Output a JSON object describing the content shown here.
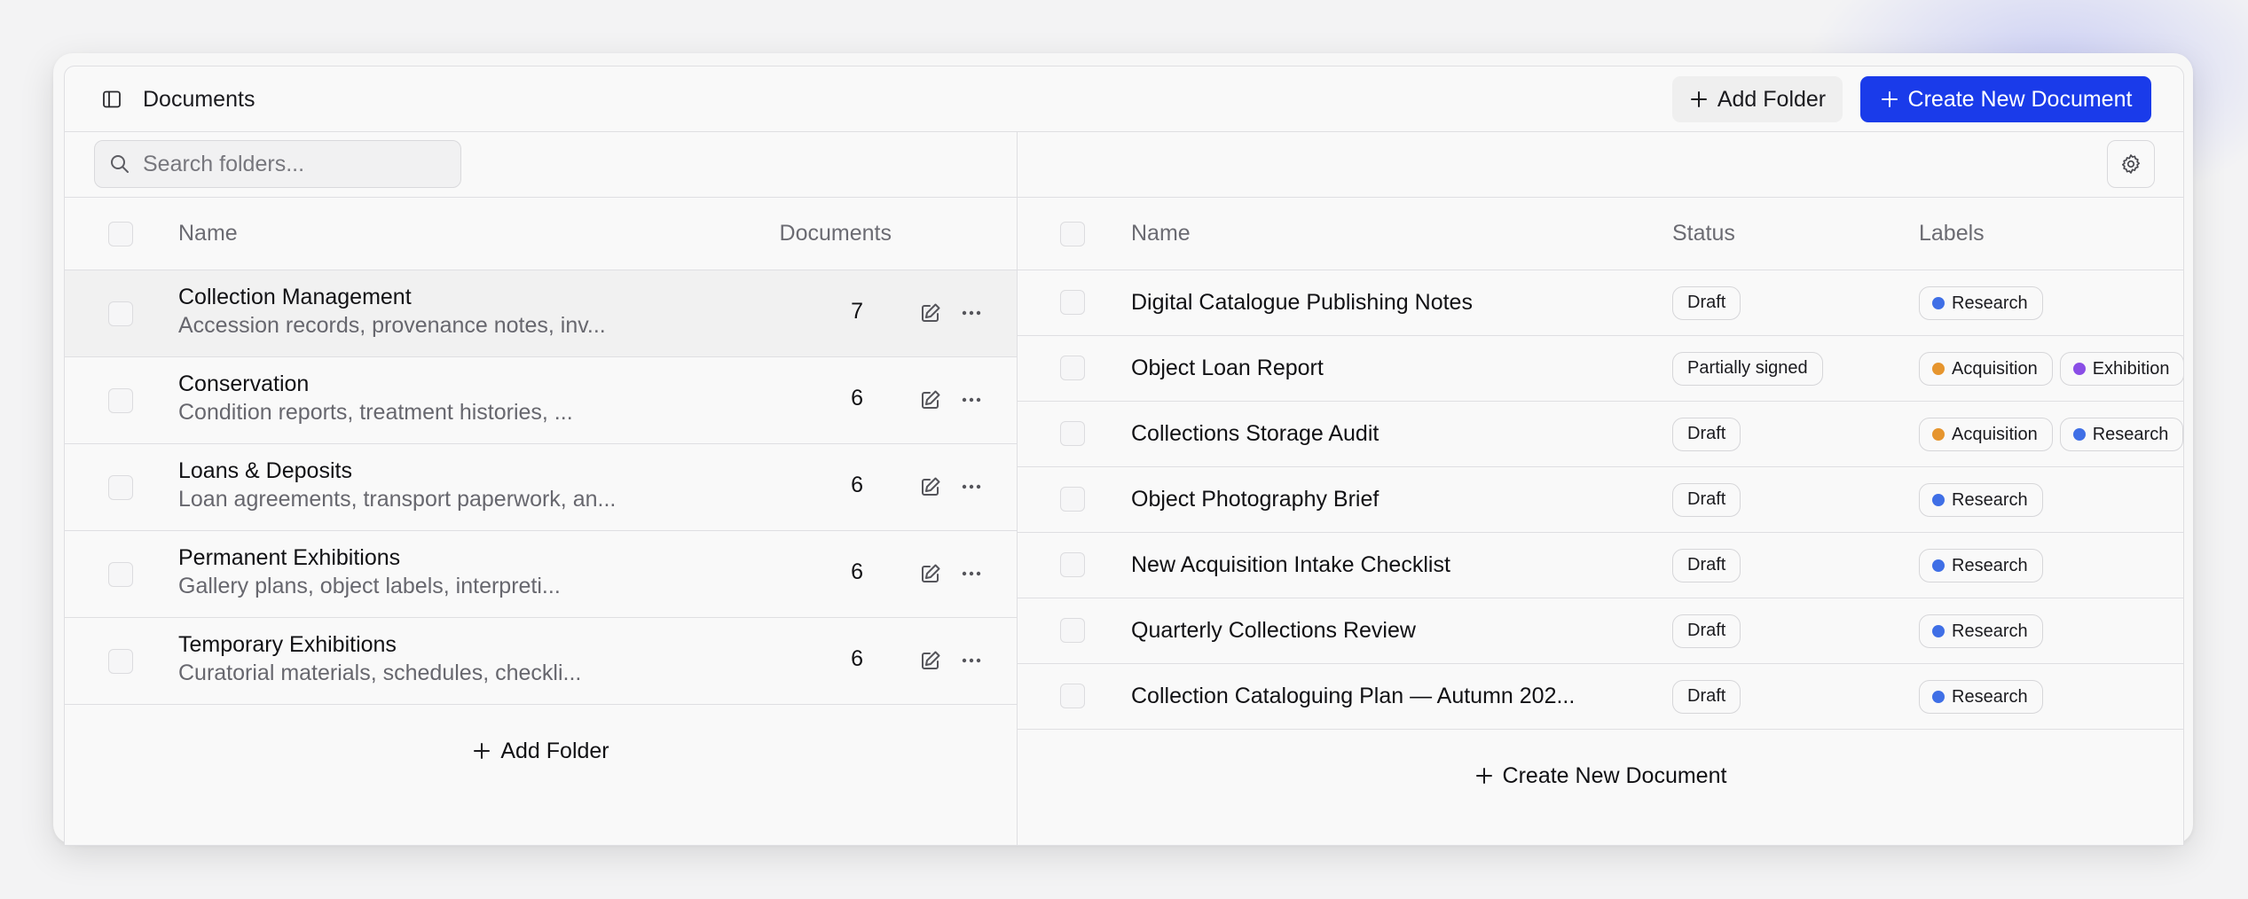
{
  "header": {
    "title": "Documents",
    "add_folder_label": "Add Folder",
    "create_document_label": "Create New Document",
    "primary_color": "#1a3bea"
  },
  "folders": {
    "search_placeholder": "Search folders...",
    "columns": {
      "name": "Name",
      "documents": "Documents"
    },
    "rows": [
      {
        "name": "Collection Management",
        "description": "Accession records, provenance notes, inv...",
        "count": "7"
      },
      {
        "name": "Conservation",
        "description": "Condition reports, treatment histories, ...",
        "count": "6"
      },
      {
        "name": "Loans & Deposits",
        "description": "Loan agreements, transport paperwork, an...",
        "count": "6"
      },
      {
        "name": "Permanent Exhibitions",
        "description": "Gallery plans, object labels, interpreti...",
        "count": "6"
      },
      {
        "name": "Temporary Exhibitions",
        "description": "Curatorial materials, schedules, checkli...",
        "count": "6"
      }
    ],
    "add_folder_label": "Add Folder"
  },
  "documents": {
    "columns": {
      "name": "Name",
      "status": "Status",
      "labels": "Labels"
    },
    "label_colors": {
      "Research": "#3f6fe6",
      "Acquisition": "#e6952e",
      "Exhibition": "#8a4ee6"
    },
    "rows": [
      {
        "name": "Digital Catalogue Publishing Notes",
        "status": "Draft",
        "labels": [
          "Research"
        ]
      },
      {
        "name": "Object Loan Report",
        "status": "Partially signed",
        "labels": [
          "Acquisition",
          "Exhibition"
        ]
      },
      {
        "name": "Collections Storage Audit",
        "status": "Draft",
        "labels": [
          "Acquisition",
          "Research"
        ]
      },
      {
        "name": "Object Photography Brief",
        "status": "Draft",
        "labels": [
          "Research"
        ]
      },
      {
        "name": "New Acquisition Intake Checklist",
        "status": "Draft",
        "labels": [
          "Research"
        ]
      },
      {
        "name": "Quarterly Collections Review",
        "status": "Draft",
        "labels": [
          "Research"
        ]
      },
      {
        "name": "Collection Cataloguing Plan — Autumn 202...",
        "status": "Draft",
        "labels": [
          "Research"
        ]
      }
    ],
    "create_document_label": "Create New Document"
  }
}
